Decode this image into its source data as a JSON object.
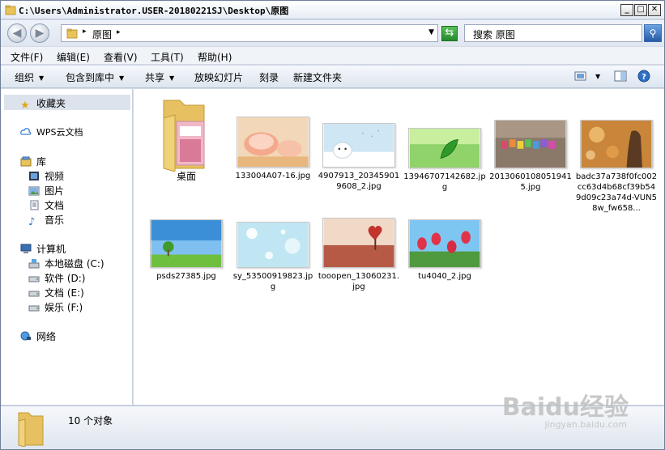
{
  "window": {
    "title": "C:\\Users\\Administrator.USER-20180221SJ\\Desktop\\原图",
    "min_label": "_",
    "max_label": "□",
    "close_label": "✕"
  },
  "nav": {
    "back": "◀",
    "forward": "▶"
  },
  "address": {
    "path": "原图",
    "sep": "▸"
  },
  "search": {
    "placeholder": "搜索 原图"
  },
  "menu": [
    "文件(F)",
    "编辑(E)",
    "查看(V)",
    "工具(T)",
    "帮助(H)"
  ],
  "toolbar": {
    "organize": "组织",
    "include_library": "包含到库中",
    "share": "共享",
    "slideshow": "放映幻灯片",
    "burn": "刻录",
    "new_folder": "新建文件夹"
  },
  "sidebar": {
    "favorites": "收藏夹",
    "wps": "WPS云文档",
    "library": "库",
    "video": "视频",
    "pictures": "图片",
    "documents": "文档",
    "music": "音乐",
    "computer": "计算机",
    "drive_c": "本地磁盘 (C:)",
    "drive_d": "软件 (D:)",
    "drive_e": "文档 (E:)",
    "drive_f": "娱乐 (F:)",
    "network": "网络"
  },
  "files": [
    {
      "name": "桌面",
      "kind": "folder"
    },
    {
      "name": "133004A07-16.jpg",
      "kind": "image"
    },
    {
      "name": "4907913_203459019608_2.jpg",
      "kind": "image"
    },
    {
      "name": "13946707142682.jpg",
      "kind": "image"
    },
    {
      "name": "20130601080519415.jpg",
      "kind": "image"
    },
    {
      "name": "badc37a738f0fc002cc63d4b68cf39b549d09c23a74d-VUN58w_fw658...",
      "kind": "image"
    },
    {
      "name": "psds27385.jpg",
      "kind": "image"
    },
    {
      "name": "sy_53500919823.jpg",
      "kind": "image"
    },
    {
      "name": "tooopen_13060231.jpg",
      "kind": "image"
    },
    {
      "name": "tu4040_2.jpg",
      "kind": "image"
    }
  ],
  "status": {
    "count": "10 个对象"
  },
  "watermark": {
    "main": "Baidu经验",
    "sub": "jingyan.baidu.com"
  }
}
